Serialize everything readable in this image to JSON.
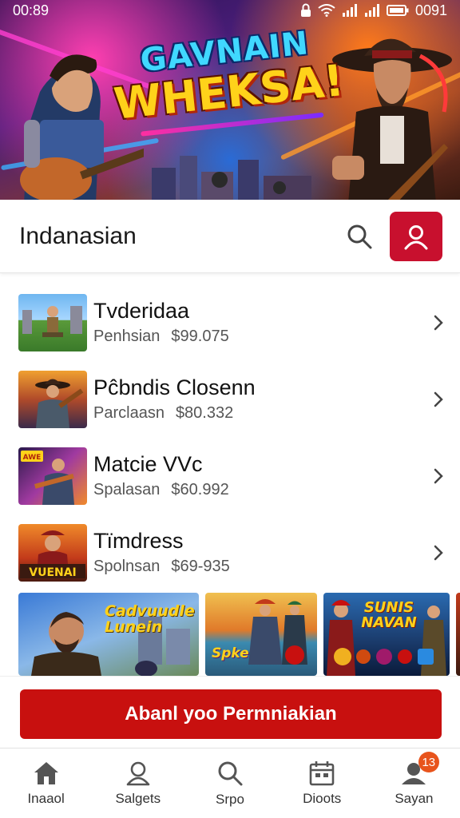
{
  "status_bar": {
    "time": "00:89",
    "battery": "0091"
  },
  "banner": {
    "line1": "GAVNAIN",
    "line2": "WHEKSA!"
  },
  "header": {
    "title": "Indanasian"
  },
  "items": [
    {
      "title": "Tvderidaa",
      "sub": "Penhsian",
      "price": "$99.075"
    },
    {
      "title": "Pĉbndis Closenn",
      "sub": "Parclaasn",
      "price": "$80.332"
    },
    {
      "title": "Matcie VVc",
      "sub": "Spalasan",
      "price": "$60.992"
    },
    {
      "title": "Tїmdress",
      "sub": "Spolnsan",
      "price": "$69-935"
    }
  ],
  "thumb_labels": {
    "item3": "AWE",
    "item4": "VUENAI"
  },
  "carousel": [
    {
      "text": "Cadvuudle Lunein"
    },
    {
      "text": "Spke"
    },
    {
      "text": "SUNIS NAVAN"
    }
  ],
  "cta": {
    "label": "Abanl yoo Permniakian"
  },
  "nav": [
    {
      "label": "Inaaol",
      "icon": "home-icon"
    },
    {
      "label": "Salgets",
      "icon": "user-icon"
    },
    {
      "label": "Srpo",
      "icon": "search-icon"
    },
    {
      "label": "Dioots",
      "icon": "calendar-icon"
    },
    {
      "label": "Sayan",
      "icon": "profile-icon",
      "badge": "13"
    }
  ],
  "colors": {
    "accent": "#c8102e",
    "badge": "#e8541c"
  }
}
